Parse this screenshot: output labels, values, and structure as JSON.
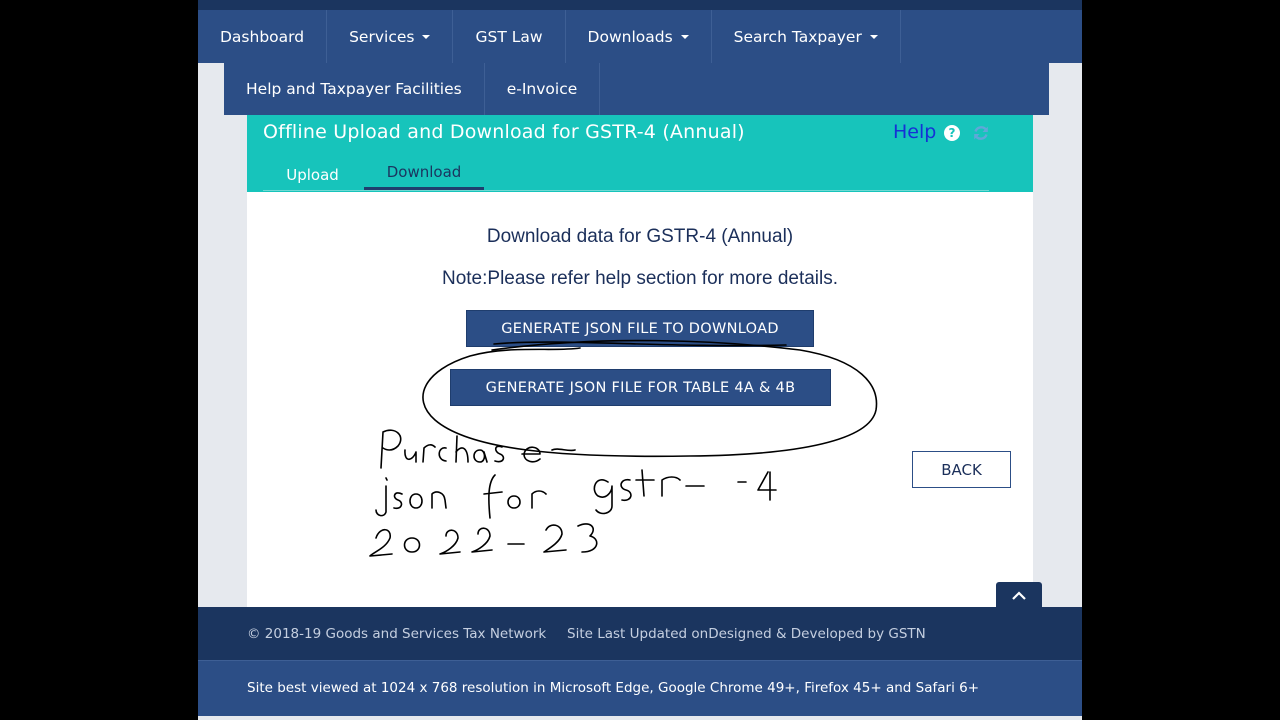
{
  "nav": {
    "row1": [
      {
        "label": "Dashboard",
        "has_caret": false
      },
      {
        "label": "Services",
        "has_caret": true
      },
      {
        "label": "GST Law",
        "has_caret": false
      },
      {
        "label": "Downloads",
        "has_caret": true
      },
      {
        "label": "Search Taxpayer",
        "has_caret": true
      }
    ],
    "row2": [
      {
        "label": "Help and Taxpayer Facilities"
      },
      {
        "label": "e-Invoice"
      }
    ]
  },
  "panel": {
    "title": "Offline Upload and Download for GSTR-4 (Annual)",
    "help_label": "Help",
    "help_icon": "question-circle-icon",
    "refresh_icon": "refresh-icon",
    "tabs": [
      {
        "label": "Upload",
        "active": false
      },
      {
        "label": "Download",
        "active": true
      }
    ]
  },
  "content": {
    "heading": "Download data for GSTR-4 (Annual)",
    "note": "Note:Please refer help section for more details.",
    "generate_json_button": "GENERATE JSON FILE TO DOWNLOAD",
    "generate_table_button": "GENERATE JSON FILE FOR TABLE 4A & 4B",
    "back_button": "BACK"
  },
  "footer": {
    "copyright": "© 2018-19 Goods and Services Tax Network",
    "site_updated": "Site Last Updated onDesigned & Developed by GSTN",
    "best_viewed": "Site best viewed at 1024 x 768 resolution in Microsoft Edge, Google Chrome 49+, Firefox 45+ and Safari 6+"
  },
  "annotation": {
    "handwriting_lines": [
      "Purchase",
      "json for gstr-4",
      "2022-23"
    ]
  },
  "colors": {
    "nav_blue": "#2c4e86",
    "dark_navy": "#1b355f",
    "teal": "#17c4bb"
  }
}
